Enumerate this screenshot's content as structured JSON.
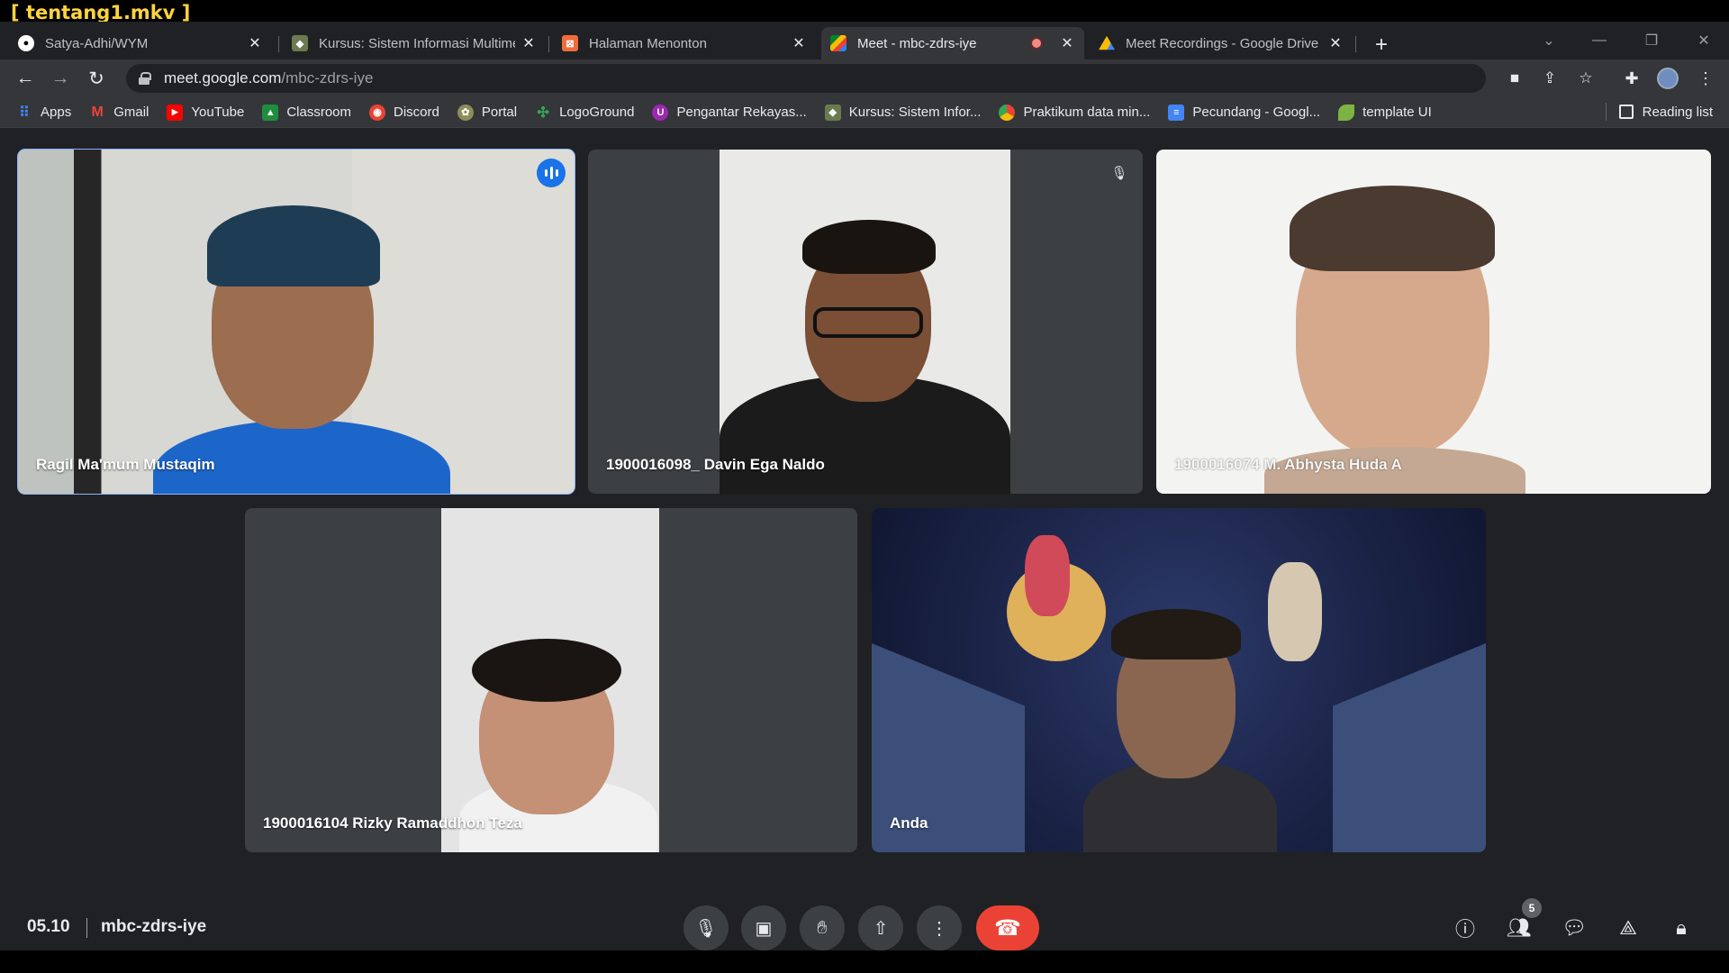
{
  "player": {
    "file_name": "[ tentang1.mkv ]"
  },
  "tabs": [
    {
      "title": "Satya-Adhi/WYM",
      "icon": "github-icon",
      "active": false
    },
    {
      "title": "Kursus: Sistem Informasi Multime",
      "icon": "course-icon",
      "active": false
    },
    {
      "title": "Halaman Menonton",
      "icon": "watch-page-icon",
      "active": false
    },
    {
      "title": "Meet - mbc-zdrs-iye",
      "icon": "meet-icon",
      "active": true,
      "recording": true
    },
    {
      "title": "Meet Recordings - Google Drive",
      "icon": "drive-icon",
      "active": false
    }
  ],
  "address_bar": {
    "host": "meet.google.com",
    "path": "/mbc-zdrs-iye"
  },
  "bookmarks": [
    {
      "label": "Apps",
      "icon": "apps-grid-icon",
      "color": "#4285f4"
    },
    {
      "label": "Gmail",
      "icon": "gmail-icon",
      "color": "#ea4335"
    },
    {
      "label": "YouTube",
      "icon": "youtube-icon",
      "color": "#ff0000"
    },
    {
      "label": "Classroom",
      "icon": "classroom-icon",
      "color": "#1e8e3e"
    },
    {
      "label": "Discord",
      "icon": "discord-icon",
      "color": "#5865f2"
    },
    {
      "label": "Portal",
      "icon": "portal-icon",
      "color": "#8d8d5a"
    },
    {
      "label": "LogoGround",
      "icon": "logoground-icon",
      "color": "#34a853"
    },
    {
      "label": "Pengantar Rekayas...",
      "icon": "course-purple-icon",
      "color": "#9c27b0"
    },
    {
      "label": "Kursus: Sistem Infor...",
      "icon": "course-icon",
      "color": "#6b7a4f"
    },
    {
      "label": "Praktikum data min...",
      "icon": "chrome-icon",
      "color": "#fbbc04"
    },
    {
      "label": "Pecundang - Googl...",
      "icon": "docs-icon",
      "color": "#4285f4"
    },
    {
      "label": "template UI",
      "icon": "leaf-icon",
      "color": "#7cb342"
    }
  ],
  "reading_list": "Reading list",
  "participants": [
    {
      "name": "Ragil Ma'mum Mustaqim",
      "speaking": true
    },
    {
      "name": "1900016098_ Davin Ega Naldo",
      "muted": true
    },
    {
      "name": "1900016074 M. Abhysta Huda A"
    },
    {
      "name": "1900016104 Rizky Ramaddhon Teza"
    },
    {
      "name": "Anda"
    }
  ],
  "meeting": {
    "time": "05.10",
    "code": "mbc-zdrs-iye",
    "participant_count": "5"
  },
  "colors": {
    "accent": "#8ab4f8",
    "end_call": "#ea4335",
    "speaking_badge": "#1a73e8",
    "background": "#202124"
  }
}
